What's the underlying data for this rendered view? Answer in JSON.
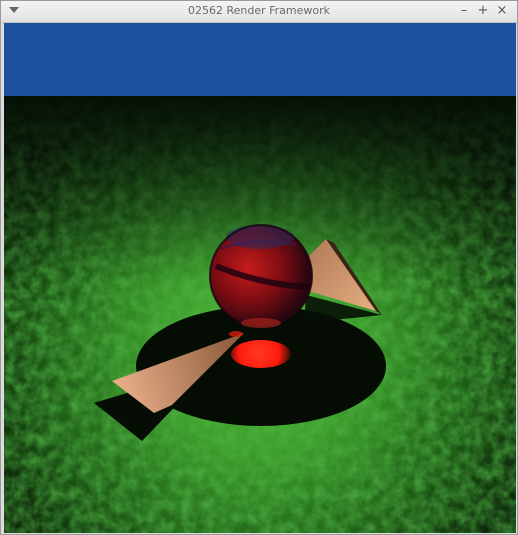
{
  "window": {
    "title": "02562 Render Framework",
    "menu_icon": "chevron-down-icon",
    "minimize_label": "–",
    "maximize_label": "+",
    "close_label": "×"
  },
  "scene": {
    "sky_color": "#1c4f9c",
    "floor_color": "#3fa82e",
    "light_color": "#ff2a1a",
    "sphere_color": "#8e1010",
    "panel_color": "#e0a67c"
  }
}
